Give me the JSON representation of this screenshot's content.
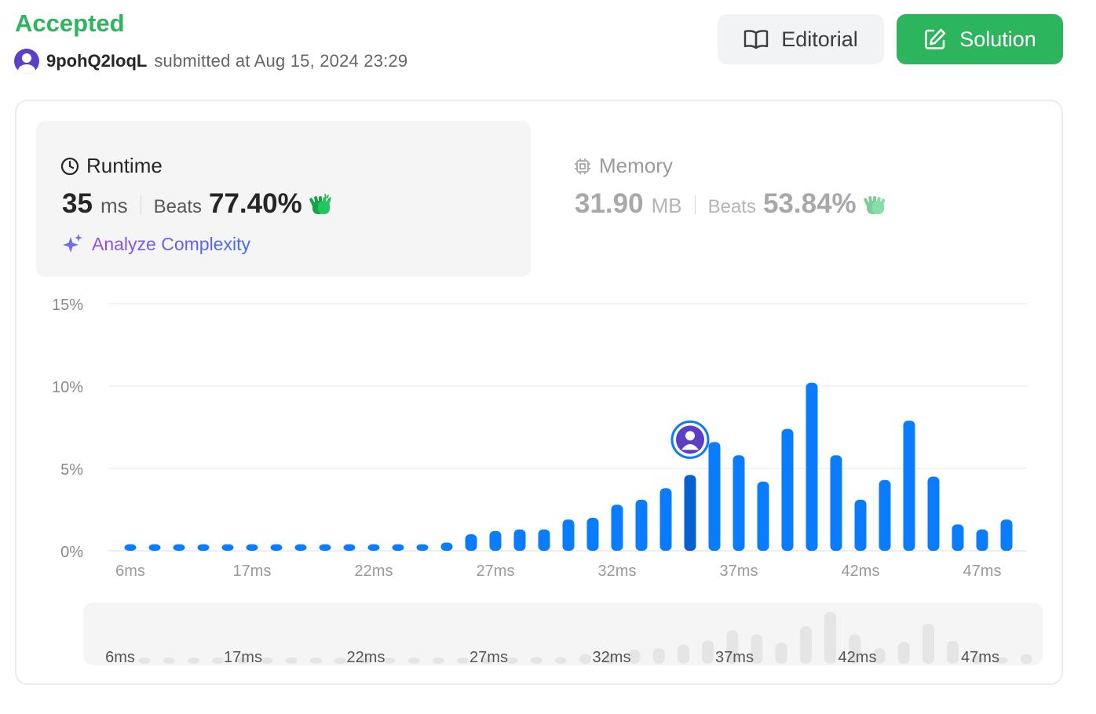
{
  "header": {
    "status": "Accepted",
    "username": "9pohQ2IoqL",
    "submitted_text": "submitted at Aug 15, 2024 23:29"
  },
  "buttons": {
    "editorial_label": "Editorial",
    "solution_label": "Solution"
  },
  "runtime": {
    "title": "Runtime",
    "value": "35",
    "unit": "ms",
    "beats_label": "Beats",
    "beats_value": "77.40%",
    "analyze_label": "Analyze Complexity"
  },
  "memory": {
    "title": "Memory",
    "value": "31.90",
    "unit": "MB",
    "beats_label": "Beats",
    "beats_value": "53.84%"
  },
  "colors": {
    "accepted": "#2db55d",
    "bar": "#0a7cff",
    "bar_selected": "#0760cf",
    "navigator_bar": "#e5e5e5"
  },
  "chart_data": {
    "type": "bar",
    "title": "",
    "xlabel": "",
    "ylabel": "",
    "ylim": [
      0,
      15
    ],
    "y_ticks": [
      "15%",
      "10%",
      "5%",
      "0%"
    ],
    "x_tick_labels": [
      "6ms",
      "17ms",
      "22ms",
      "27ms",
      "32ms",
      "37ms",
      "42ms",
      "47ms"
    ],
    "selected_index": 23,
    "grid": true,
    "series": [
      {
        "values": [
          0.4,
          0.4,
          0.4,
          0.4,
          0.4,
          0.4,
          0.4,
          0.4,
          0.4,
          0.4,
          0.4,
          0.4,
          0.4,
          0.5,
          1.0,
          1.2,
          1.3,
          1.3,
          1.9,
          2.0,
          2.8,
          3.1,
          3.8,
          4.6,
          6.6,
          5.8,
          4.2,
          7.4,
          10.2,
          5.8,
          3.1,
          4.3,
          7.9,
          4.5,
          1.6,
          1.3,
          1.9
        ]
      }
    ],
    "navigator": {
      "x_tick_labels": [
        "6ms",
        "17ms",
        "22ms",
        "27ms",
        "32ms",
        "37ms",
        "42ms",
        "47ms"
      ]
    }
  }
}
